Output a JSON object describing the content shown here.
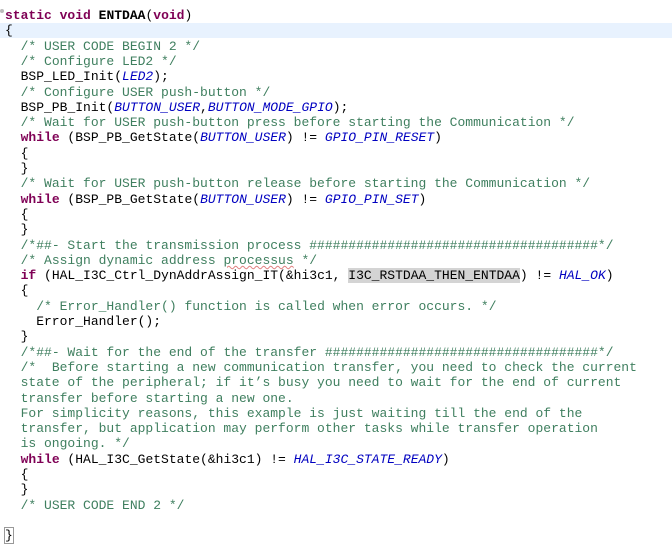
{
  "editor": {
    "current_line": 1,
    "lines": [
      [
        [
          "kw",
          "static"
        ],
        [
          "",
          ""
        ],
        [
          "t",
          " "
        ],
        [
          "kw",
          "void"
        ],
        [
          "t",
          " "
        ],
        [
          "b",
          "ENTDAA"
        ],
        [
          "t",
          "("
        ],
        [
          "kw",
          "void"
        ],
        [
          "t",
          ")"
        ]
      ],
      [
        [
          "t",
          "{"
        ]
      ],
      [
        [
          "t",
          "  "
        ],
        [
          "cm",
          "/* USER CODE BEGIN 2 */"
        ]
      ],
      [
        [
          "t",
          "  "
        ],
        [
          "cm",
          "/* Configure LED2 */"
        ]
      ],
      [
        [
          "t",
          "  BSP_LED_Init("
        ],
        [
          "mc",
          "LED2"
        ],
        [
          "t",
          ");"
        ]
      ],
      [
        [
          "t",
          "  "
        ],
        [
          "cm",
          "/* Configure USER push-button */"
        ]
      ],
      [
        [
          "t",
          "  BSP_PB_Init("
        ],
        [
          "mc",
          "BUTTON_USER"
        ],
        [
          "t",
          ","
        ],
        [
          "mc",
          "BUTTON_MODE_GPIO"
        ],
        [
          "t",
          ");"
        ]
      ],
      [
        [
          "t",
          "  "
        ],
        [
          "cm",
          "/* Wait for USER push-button press before starting the Communication */"
        ]
      ],
      [
        [
          "t",
          "  "
        ],
        [
          "kw",
          "while"
        ],
        [
          "t",
          " (BSP_PB_GetState("
        ],
        [
          "mc",
          "BUTTON_USER"
        ],
        [
          "t",
          ") != "
        ],
        [
          "mc",
          "GPIO_PIN_RESET"
        ],
        [
          "t",
          ")"
        ]
      ],
      [
        [
          "t",
          "  {"
        ]
      ],
      [
        [
          "t",
          "  }"
        ]
      ],
      [
        [
          "t",
          "  "
        ],
        [
          "cm",
          "/* Wait for USER push-button release before starting the Communication */"
        ]
      ],
      [
        [
          "t",
          "  "
        ],
        [
          "kw",
          "while"
        ],
        [
          "t",
          " (BSP_PB_GetState("
        ],
        [
          "mc",
          "BUTTON_USER"
        ],
        [
          "t",
          ") != "
        ],
        [
          "mc",
          "GPIO_PIN_SET"
        ],
        [
          "t",
          ")"
        ]
      ],
      [
        [
          "t",
          "  {"
        ]
      ],
      [
        [
          "t",
          "  }"
        ]
      ],
      [
        [
          "t",
          "  "
        ],
        [
          "cm",
          "/*##- Start the transmission process #####################################*/"
        ]
      ],
      [
        [
          "t",
          "  "
        ],
        [
          "cm",
          "/* Assign dynamic address "
        ],
        [
          "cmsq",
          "processus"
        ],
        [
          "cm",
          " */"
        ]
      ],
      [
        [
          "t",
          "  "
        ],
        [
          "kw",
          "if"
        ],
        [
          "t",
          " (HAL_I3C_Ctrl_DynAddrAssign_IT(&hi3c1, "
        ],
        [
          "hl",
          "I3C_RSTDAA_THEN_ENTDAA"
        ],
        [
          "t",
          ") != "
        ],
        [
          "mc",
          "HAL_OK"
        ],
        [
          "t",
          ")"
        ]
      ],
      [
        [
          "t",
          "  {"
        ]
      ],
      [
        [
          "t",
          "    "
        ],
        [
          "cm",
          "/* Error_Handler() function is called when error occurs. */"
        ]
      ],
      [
        [
          "t",
          "    Error_Handler();"
        ]
      ],
      [
        [
          "t",
          "  }"
        ]
      ],
      [
        [
          "t",
          "  "
        ],
        [
          "cm",
          "/*##- Wait for the end of the transfer ###################################*/"
        ]
      ],
      [
        [
          "t",
          "  "
        ],
        [
          "cm",
          "/*  Before starting a new communication transfer, you need to check the current"
        ]
      ],
      [
        [
          "cm",
          "  state of the peripheral; if it’s busy you need to wait for the end of current"
        ]
      ],
      [
        [
          "cm",
          "  transfer before starting a new one."
        ]
      ],
      [
        [
          "cm",
          "  For simplicity reasons, this example is just waiting till the end of the"
        ]
      ],
      [
        [
          "cm",
          "  transfer, but application may perform other tasks while transfer operation"
        ]
      ],
      [
        [
          "cm",
          "  is ongoing. */"
        ]
      ],
      [
        [
          "t",
          "  "
        ],
        [
          "kw",
          "while"
        ],
        [
          "t",
          " (HAL_I3C_GetState(&hi3c1) != "
        ],
        [
          "mc",
          "HAL_I3C_STATE_READY"
        ],
        [
          "t",
          ")"
        ]
      ],
      [
        [
          "t",
          "  {"
        ]
      ],
      [
        [
          "t",
          "  }"
        ]
      ],
      [
        [
          "t",
          "  "
        ],
        [
          "cm",
          "/* USER CODE END 2 */"
        ]
      ],
      [],
      [
        [
          "br",
          "}"
        ]
      ]
    ]
  }
}
